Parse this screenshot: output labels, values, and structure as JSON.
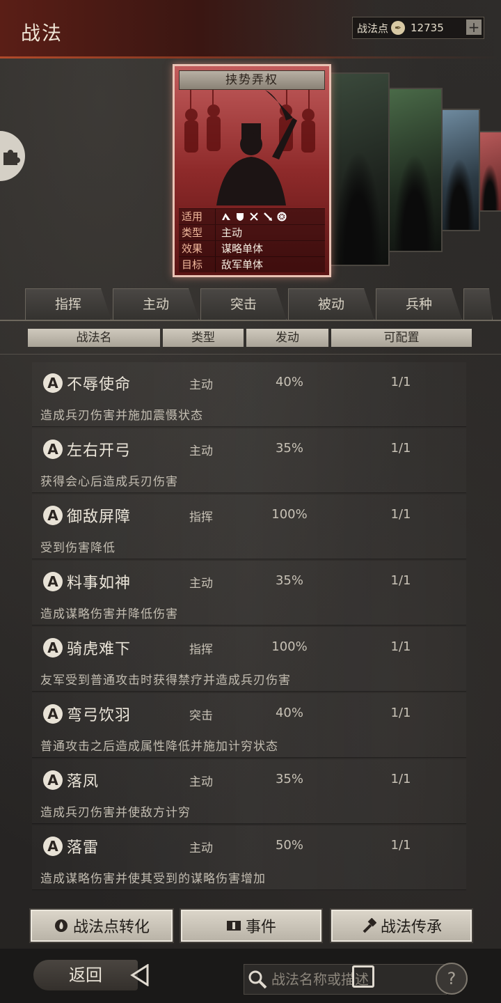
{
  "header": {
    "title": "战法",
    "points_label": "战法点",
    "points_value": "12735",
    "plus_icon": "plus-icon"
  },
  "card": {
    "name": "挟势弄权",
    "rows": [
      {
        "key": "适用",
        "value": ""
      },
      {
        "key": "类型",
        "value": "主动"
      },
      {
        "key": "效果",
        "value": "谋略单体"
      },
      {
        "key": "目标",
        "value": "敌军单体"
      }
    ],
    "applicable_icons": [
      "cavalry-icon",
      "shield-icon",
      "bow-icon",
      "spear-icon",
      "siege-icon"
    ]
  },
  "tabs": [
    "指挥",
    "主动",
    "突击",
    "被动",
    "兵种"
  ],
  "columns": {
    "name": "战法名",
    "type": "类型",
    "trigger": "发动",
    "config": "可配置"
  },
  "items": [
    {
      "grade": "A",
      "name": "不辱使命",
      "type": "主动",
      "rate": "40%",
      "count": "1/1",
      "desc": "造成兵刃伤害并施加震慑状态"
    },
    {
      "grade": "A",
      "name": "左右开弓",
      "type": "主动",
      "rate": "35%",
      "count": "1/1",
      "desc": "获得会心后造成兵刃伤害"
    },
    {
      "grade": "A",
      "name": "御敌屏障",
      "type": "指挥",
      "rate": "100%",
      "count": "1/1",
      "desc": "受到伤害降低"
    },
    {
      "grade": "A",
      "name": "料事如神",
      "type": "主动",
      "rate": "35%",
      "count": "1/1",
      "desc": "造成谋略伤害并降低伤害"
    },
    {
      "grade": "A",
      "name": "骑虎难下",
      "type": "指挥",
      "rate": "100%",
      "count": "1/1",
      "desc": "友军受到普通攻击时获得禁疗并造成兵刃伤害"
    },
    {
      "grade": "A",
      "name": "弯弓饮羽",
      "type": "突击",
      "rate": "40%",
      "count": "1/1",
      "desc": "普通攻击之后造成属性降低并施加计穷状态"
    },
    {
      "grade": "A",
      "name": "落凤",
      "type": "主动",
      "rate": "35%",
      "count": "1/1",
      "desc": "造成兵刃伤害并使敌方计穷"
    },
    {
      "grade": "A",
      "name": "落雷",
      "type": "主动",
      "rate": "50%",
      "count": "1/1",
      "desc": "造成谋略伤害并使其受到的谋略伤害增加"
    }
  ],
  "buttons": {
    "convert": "战法点转化",
    "event": "事件",
    "inherit": "战法传承"
  },
  "nav": {
    "back": "返回",
    "search_placeholder": "战法名称或描述",
    "help": "?"
  }
}
